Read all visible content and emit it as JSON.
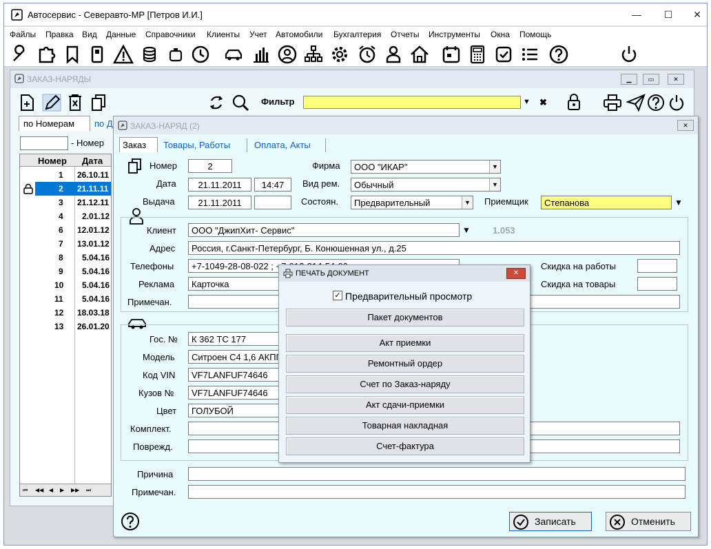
{
  "app": {
    "title": "Автосервис - Северавто-МР  [Петров И.И.]"
  },
  "menu": [
    "Файлы",
    "Правка",
    "Вид",
    "Данные",
    "Справочники",
    "Клиенты",
    "Учет",
    "Автомобили",
    "Бухгалтерия",
    "Отчеты",
    "Инструменты",
    "Окна",
    "Помощь"
  ],
  "toolbar_icons": [
    "wrench-icon",
    "puzzle-icon",
    "bookmark-icon",
    "phone-book-icon",
    "warning-icon",
    "coins-icon",
    "battery-icon",
    "history-icon",
    "car-icon",
    "bar-chart-icon",
    "user-circle-icon",
    "org-chart-icon",
    "gear-icon",
    "alarm-icon",
    "person-icon",
    "home-icon",
    "calendar-icon",
    "calculator-icon",
    "checkbox-icon",
    "list-icon",
    "help-icon",
    "power-icon"
  ],
  "list_window": {
    "title": "ЗАКАЗ-НАРЯДЫ",
    "filter_label": "Фильтр",
    "tab_numbers": "по Номерам",
    "tab_dates": "по Д",
    "search_label": "- Номер",
    "columns": [
      "Номер",
      "Дата"
    ],
    "rows": [
      [
        "1",
        "26.10.11"
      ],
      [
        "2",
        "21.11.11"
      ],
      [
        "3",
        "21.12.11"
      ],
      [
        "4",
        "2.01.12"
      ],
      [
        "6",
        "12.01.12"
      ],
      [
        "7",
        "13.01.12"
      ],
      [
        "8",
        "5.04.16"
      ],
      [
        "9",
        "5.04.16"
      ],
      [
        "10",
        "5.04.16"
      ],
      [
        "11",
        "5.04.16"
      ],
      [
        "12",
        "18.03.18"
      ],
      [
        "13",
        "26.01.20"
      ]
    ],
    "nav": [
      "⏮",
      "◀◀",
      "◀",
      "▶",
      "▶▶",
      "⏭"
    ]
  },
  "order": {
    "title": "ЗАКАЗ-НАРЯД",
    "count": "(2)",
    "tabs": [
      "Заказ",
      "Товары, Работы",
      "Оплата, Акты"
    ],
    "number_label": "Номер",
    "number": "2",
    "date_label": "Дата",
    "date": "21.11.2011",
    "time": "14:47",
    "issue_label": "Выдача",
    "issue_date": "21.11.2011",
    "firm_label": "Фирма",
    "firm": "ООО \"ИКАР\"",
    "repair_label": "Вид рем.",
    "repair": "Обычный",
    "state_label": "Состоян.",
    "state": "Предварительный",
    "receiver_label": "Приемщик",
    "receiver": "Степанова",
    "client_label": "Клиент",
    "client": "ООО \"ДжипХит- Сервис\"",
    "client_balance": "1.053",
    "address_label": "Адрес",
    "address": "Россия, г.Санкт-Петербург, Б. Конюшенная ул., д.25",
    "phones_label": "Телефоны",
    "phones": "+7-1049-28-08-022 ; +7-913-814-54-00",
    "ads_label": "Реклама",
    "ads": "Карточка",
    "note_label": "Примечан.",
    "note": "",
    "disc_work_label": "Скидка на работы",
    "disc_goods_label": "Скидка на товары",
    "plate_label": "Гос. №",
    "plate": "К 362 ТС 177",
    "model_label": "Модель",
    "model": "Ситроен С4 1,6 АКПП",
    "vin_label": "Код VIN",
    "vin": "VF7LANFUF74646",
    "body_label": "Кузов №",
    "body": "VF7LANFUF74646",
    "color_label": "Цвет",
    "color": "ГОЛУБОЙ",
    "kit_label": "Комплект.",
    "damage_label": "Поврежд.",
    "reason_label": "Причина",
    "note2_label": "Примечан.",
    "save": "Записать",
    "cancel": "Отменить"
  },
  "print_dialog": {
    "title": "ПЕЧАТЬ ДОКУМЕНТ",
    "preview": "Предварительный просмотр",
    "buttons": [
      "Пакет документов",
      "Акт приемки",
      "Ремонтный ордер",
      "Счет по Заказ-наряду",
      "Акт сдачи-приемки",
      "Товарная накладная",
      "Счет-фактура"
    ]
  },
  "colors": {
    "accent": "#0a64c8",
    "filter_bg": "#ffff80",
    "selected_row": "#0078d7"
  }
}
